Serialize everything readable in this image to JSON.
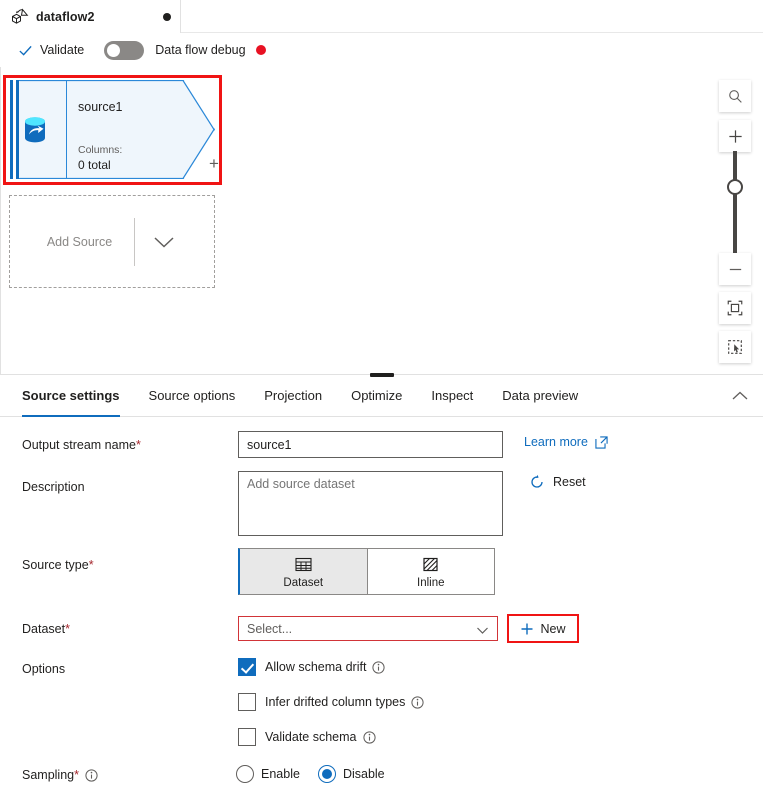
{
  "tab": {
    "icon": "dataflow-icon",
    "title": "dataflow2",
    "dirty_indicator": "unsaved-dot"
  },
  "commandbar": {
    "validate_label": "Validate",
    "validate_icon": "checkmark-icon",
    "debug_toggle_state": "off",
    "debug_label": "Data flow debug",
    "debug_status_color": "#e81123"
  },
  "canvas": {
    "node": {
      "name": "source1",
      "columns_label": "Columns:",
      "columns_value": "0 total",
      "icon": "database-source-icon",
      "add_output_glyph": "+",
      "selected": true,
      "selection_color": "#f01414"
    },
    "add_source": {
      "label": "Add Source",
      "chevron_icon": "chevron-down-icon"
    },
    "toolbar": {
      "search_icon": "search-icon",
      "zoom_in_icon": "plus-icon",
      "zoom_out_icon": "minus-icon",
      "fit_icon": "fit-to-screen-icon",
      "marquee_icon": "marquee-select-icon"
    }
  },
  "panel": {
    "tabs": [
      {
        "label": "Source settings",
        "active": true
      },
      {
        "label": "Source options",
        "active": false
      },
      {
        "label": "Projection",
        "active": false
      },
      {
        "label": "Optimize",
        "active": false
      },
      {
        "label": "Inspect",
        "active": false
      },
      {
        "label": "Data preview",
        "active": false
      }
    ],
    "collapse_icon": "chevron-up-icon",
    "accent_color": "#0f6cbd"
  },
  "form": {
    "output_stream_name": {
      "label": "Output stream name",
      "required": "*",
      "value": "source1"
    },
    "learn_more": {
      "label": "Learn more",
      "icon": "external-link-icon"
    },
    "description": {
      "label": "Description",
      "placeholder": "Add source dataset",
      "value": ""
    },
    "reset": {
      "label": "Reset",
      "icon": "refresh-icon"
    },
    "source_type": {
      "label": "Source type",
      "required": "*",
      "options": [
        {
          "label": "Dataset",
          "icon": "table-grid-icon",
          "selected": true
        },
        {
          "label": "Inline",
          "icon": "hatched-square-icon",
          "selected": false
        }
      ]
    },
    "dataset": {
      "label": "Dataset",
      "required": "*",
      "selected_value": "Select...",
      "error": true,
      "chevron_icon": "chevron-down-icon",
      "new_button": {
        "label": "New",
        "icon": "plus-icon",
        "highlight_color": "#f01414"
      }
    },
    "options": {
      "label": "Options",
      "items": [
        {
          "label": "Allow schema drift",
          "checked": true,
          "info_icon": "info-icon"
        },
        {
          "label": "Infer drifted column types",
          "checked": false,
          "info_icon": "info-icon"
        },
        {
          "label": "Validate schema",
          "checked": false,
          "info_icon": "info-icon"
        }
      ]
    },
    "sampling": {
      "label": "Sampling",
      "required": "*",
      "info_icon": "info-icon",
      "options": [
        {
          "label": "Enable",
          "selected": false
        },
        {
          "label": "Disable",
          "selected": true
        }
      ]
    }
  }
}
